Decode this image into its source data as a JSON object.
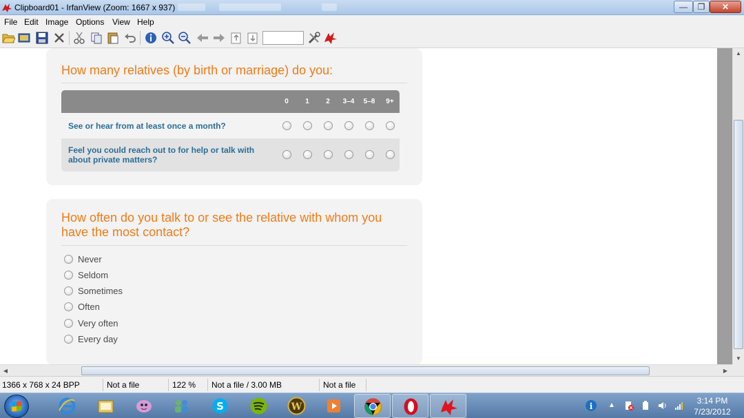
{
  "window": {
    "title": "Clipboard01 - IrfanView (Zoom: 1667 x 937)",
    "minimize": "—",
    "maximize": "❐",
    "close": "✕"
  },
  "menu": [
    "File",
    "Edit",
    "Image",
    "Options",
    "View",
    "Help"
  ],
  "toolbar_icons": [
    "open-icon",
    "thumbnails-icon",
    "save-icon",
    "delete-icon",
    "cut-icon",
    "copy-icon",
    "paste-icon",
    "undo-icon",
    "info-icon",
    "zoom-in-icon",
    "zoom-out-icon",
    "previous-icon",
    "next-icon",
    "first-page-icon",
    "last-page-icon",
    "settings-icon",
    "irfanview-icon"
  ],
  "survey": {
    "q1": {
      "title": "How many relatives (by birth or marriage) do you:",
      "columns": [
        "0",
        "1",
        "2",
        "3–4",
        "5–8",
        "9+"
      ],
      "rows": [
        {
          "label": "See or hear from at least once a month?"
        },
        {
          "label": "Feel you could reach out to for help or talk with about private matters?"
        }
      ]
    },
    "q2": {
      "title": "How often do you talk to or see the relative with whom you have the most contact?",
      "options": [
        "Never",
        "Seldom",
        "Sometimes",
        "Often",
        "Very often",
        "Every day"
      ]
    }
  },
  "status": {
    "dims": "1366 x 768 x 24 BPP",
    "file1": "Not a file",
    "zoom": "122 %",
    "file_size": "Not a file / 3.00 MB",
    "file2": "Not a file"
  },
  "taskbar": {
    "apps": [
      "internet-explorer-icon",
      "windows-explorer-icon",
      "messenger-icon",
      "contacts-icon",
      "skype-icon",
      "spotify-icon",
      "world-of-warcraft-icon",
      "media-player-icon",
      "chrome-icon",
      "opera-icon",
      "irfanview-icon"
    ],
    "time": "3:14 PM",
    "date": "7/23/2012"
  },
  "colors": {
    "accent_orange": "#f07b16",
    "row_label_blue": "#2a6e97",
    "grid_header": "#8a8a8a"
  }
}
